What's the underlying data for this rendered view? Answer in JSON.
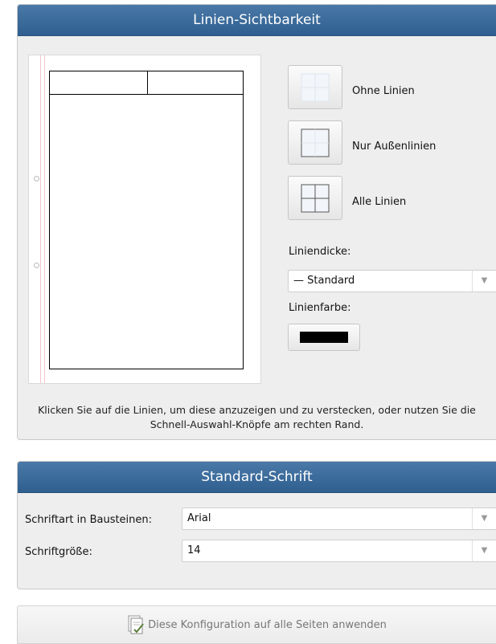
{
  "line_visibility": {
    "title": "Linien-Sichtbarkeit",
    "quick_buttons": [
      {
        "label": "Ohne Linien",
        "icon": "no-lines-icon"
      },
      {
        "label": "Nur Außenlinien",
        "icon": "outer-lines-icon"
      },
      {
        "label": "Alle Linien",
        "icon": "all-lines-icon"
      }
    ],
    "thickness_label": "Liniendicke:",
    "thickness_value": "— Standard",
    "color_label": "Linienfarbe:",
    "color_value": "#000000",
    "hint": "Klicken Sie auf die Linien, um diese anzuzeigen und zu verstecken, oder nutzen Sie die Schnell-Auswahl-Knöpfe am rechten Rand."
  },
  "standard_font": {
    "title": "Standard-Schrift",
    "font_label": "Schriftart in Bausteinen:",
    "font_value": "Arial",
    "size_label": "Schriftgröße:",
    "size_value": "14"
  },
  "apply_button": {
    "label": "Diese Konfiguration auf alle Seiten anwenden",
    "icon": "apply-pages-icon"
  },
  "colors": {
    "header_blue": "#3a6a9a",
    "panel_bg": "#eeeeee"
  }
}
